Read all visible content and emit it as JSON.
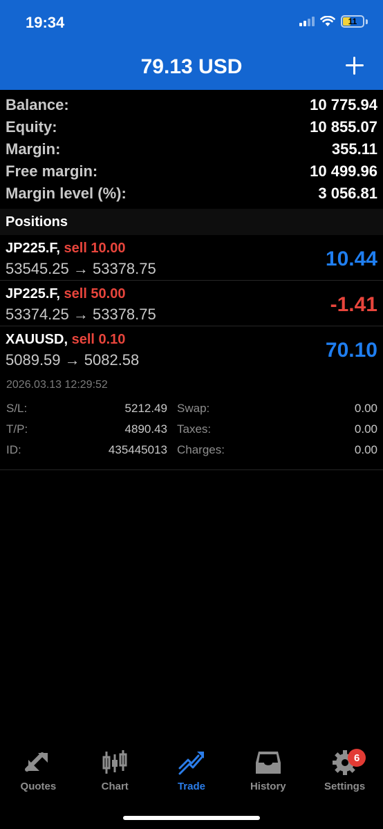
{
  "status_bar": {
    "time": "19:34",
    "battery": "11"
  },
  "header": {
    "title": "79.13 USD"
  },
  "summary": [
    {
      "label": "Balance:",
      "value": "10 775.94"
    },
    {
      "label": "Equity:",
      "value": "10 855.07"
    },
    {
      "label": "Margin:",
      "value": "355.11"
    },
    {
      "label": "Free margin:",
      "value": "10 499.96"
    },
    {
      "label": "Margin level (%):",
      "value": "3 056.81"
    }
  ],
  "positions_title": "Positions",
  "positions": [
    {
      "symbol": "JP225.F,",
      "type": "sell 10.00",
      "prices": "53545.25 → 53378.75",
      "profit": "10.44",
      "profit_color": "#1f7ef0"
    },
    {
      "symbol": "JP225.F,",
      "type": "sell 50.00",
      "prices": "53374.25 → 53378.75",
      "profit": "-1.41",
      "profit_color": "#e8453c"
    },
    {
      "symbol": "XAUUSD,",
      "type": "sell 0.10",
      "prices": "5089.59 → 5082.58",
      "profit": "70.10",
      "profit_color": "#1f7ef0"
    }
  ],
  "details": {
    "date": "2026.03.13 12:29:52",
    "sl_label": "S/L:",
    "sl_value": "5212.49",
    "tp_label": "T/P:",
    "tp_value": "4890.43",
    "id_label": "ID:",
    "id_value": "435445013",
    "swap_label": "Swap:",
    "swap_value": "0.00",
    "taxes_label": "Taxes:",
    "taxes_value": "0.00",
    "charges_label": "Charges:",
    "charges_value": "0.00"
  },
  "tabs": [
    {
      "label": "Quotes",
      "icon": "quotes-icon"
    },
    {
      "label": "Chart",
      "icon": "chart-icon"
    },
    {
      "label": "Trade",
      "icon": "trade-icon",
      "active": true
    },
    {
      "label": "History",
      "icon": "history-icon"
    },
    {
      "label": "Settings",
      "icon": "settings-icon",
      "badge": "6"
    }
  ],
  "colors": {
    "header_bg": "#1466d1",
    "profit_positive": "#1f7ef0",
    "loss": "#e8453c",
    "active_tab": "#2b7de9"
  }
}
